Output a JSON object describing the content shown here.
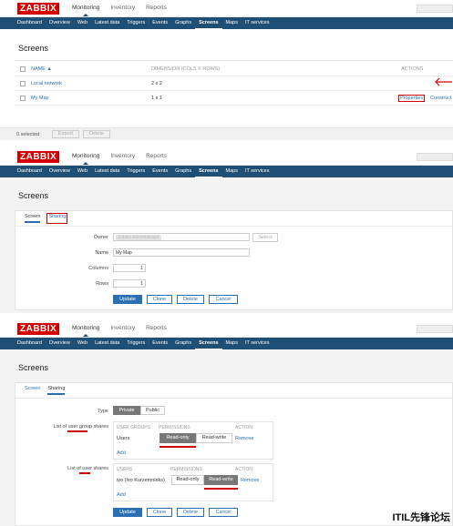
{
  "brand": "ZABBIX",
  "topnav": [
    "Monitoring",
    "Inventory",
    "Reports"
  ],
  "subnav": [
    "Dashboard",
    "Overview",
    "Web",
    "Latest data",
    "Triggers",
    "Events",
    "Graphs",
    "Screens",
    "Maps",
    "IT services"
  ],
  "page_title": "Screens",
  "list": {
    "col_name": "NAME ▲",
    "col_dimension": "DIMENSION (COLS X ROWS)",
    "col_actions": "ACTIONS",
    "rows": [
      {
        "name": "Local network",
        "dimension": "2 x 2"
      },
      {
        "name": "My Map",
        "dimension": "1 x 1",
        "properties": "Properties",
        "constructor": "Construct"
      }
    ],
    "selected": "0 selected",
    "export": "Export",
    "delete": "Delete"
  },
  "tabs": {
    "screen": "Screen",
    "sharing": "Sharing"
  },
  "form2": {
    "owner_label": "Owner",
    "owner_value": "Zabbix Administrator",
    "select": "Select",
    "name_label": "Name",
    "name_value": "My Map",
    "columns_label": "Columns",
    "columns_value": "1",
    "rows_label": "Rows",
    "rows_value": "1"
  },
  "buttons": {
    "update": "Update",
    "clone": "Clone",
    "delete": "Delete",
    "cancel": "Cancel"
  },
  "form3": {
    "type_label": "Type",
    "type_private": "Private",
    "type_public": "Public",
    "group_label": "List of user group shares",
    "group_col1": "USER GROUPS",
    "group_col2": "PERMISSIONS",
    "group_col3": "ACTION",
    "group_row_name": "Users",
    "readonly": "Read-only",
    "readwrite": "Read-write",
    "remove": "Remove",
    "add": "Add",
    "user_label": "List of user shares",
    "user_col1": "USERS",
    "user_row_name": "ivo (Ivo Kurzemnieks)"
  },
  "watermark": "ITIL先锋论坛",
  "colors": {
    "brand_red": "#d40000",
    "nav_blue": "#1f4f74",
    "link_blue": "#2a6fb2"
  }
}
